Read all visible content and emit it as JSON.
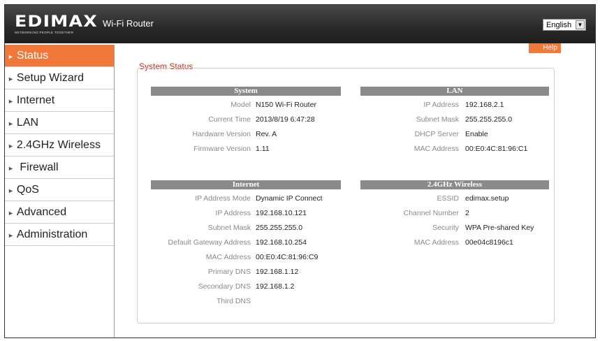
{
  "header": {
    "brand": "EDIMAX",
    "tagline": "NETWORKING PEOPLE TOGETHER",
    "product": "Wi-Fi Router",
    "language": {
      "selected": "English",
      "arrow": "▼"
    }
  },
  "sidebar": {
    "items": [
      {
        "label": "Status",
        "active": true
      },
      {
        "label": "Setup Wizard"
      },
      {
        "label": "Internet"
      },
      {
        "label": "LAN"
      },
      {
        "label": "2.4GHz Wireless"
      },
      {
        "label": "Firewall"
      },
      {
        "label": "QoS"
      },
      {
        "label": "Advanced"
      },
      {
        "label": "Administration"
      }
    ]
  },
  "help_label": "Help",
  "system_status": {
    "title": "System Status",
    "system": {
      "heading": "System",
      "rows": [
        {
          "label": "Model",
          "value": "N150 Wi-Fi Router"
        },
        {
          "label": "Current Time",
          "value": "2013/8/19  6:47:28"
        },
        {
          "label": "Hardware Version",
          "value": "Rev. A"
        },
        {
          "label": "Firmware Version",
          "value": "1.11"
        }
      ]
    },
    "lan": {
      "heading": "LAN",
      "rows": [
        {
          "label": "IP Address",
          "value": "192.168.2.1"
        },
        {
          "label": "Subnet Mask",
          "value": "255.255.255.0"
        },
        {
          "label": "DHCP Server",
          "value": "Enable"
        },
        {
          "label": "MAC Address",
          "value": "00:E0:4C:81:96:C1"
        }
      ]
    },
    "internet": {
      "heading": "Internet",
      "rows": [
        {
          "label": "IP Address Mode",
          "value": "Dynamic IP  Connect"
        },
        {
          "label": "IP Address",
          "value": "192.168.10.121"
        },
        {
          "label": "Subnet Mask",
          "value": "255.255.255.0"
        },
        {
          "label": "Default Gateway Address",
          "value": "192.168.10.254"
        },
        {
          "label": "MAC Address",
          "value": "00:E0:4C:81:96:C9"
        },
        {
          "label": "Primary DNS",
          "value": "192.168.1.12"
        },
        {
          "label": "Secondary DNS",
          "value": "192.168.1.2"
        },
        {
          "label": "Third DNS",
          "value": ""
        }
      ]
    },
    "wireless": {
      "heading": "2.4GHz  Wireless",
      "rows": [
        {
          "label": "ESSID",
          "value": "edimax.setup"
        },
        {
          "label": "Channel Number",
          "value": "2"
        },
        {
          "label": "Security",
          "value": "WPA Pre-shared Key"
        },
        {
          "label": "MAC Address",
          "value": "00e04c8196c1"
        }
      ]
    }
  },
  "colors": {
    "accent": "#f07838",
    "title_red": "#cc2a14",
    "section_gray": "#8a8a8a"
  }
}
